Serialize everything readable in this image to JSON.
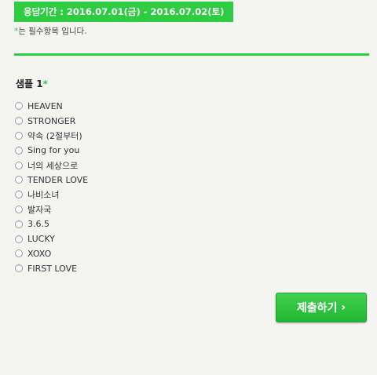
{
  "banner": {
    "period_text": "응답기간 : 2016.07.01(금) - 2016.07.02(토)"
  },
  "required_note": {
    "star": "*",
    "text": "는 필수항목 입니다."
  },
  "question": {
    "title": "샘플 1",
    "required_mark": "*",
    "options": [
      {
        "label": "HEAVEN"
      },
      {
        "label": "STRONGER"
      },
      {
        "label": "약속 (2절부터)"
      },
      {
        "label": "Sing for you"
      },
      {
        "label": "너의 세상으로"
      },
      {
        "label": "TENDER LOVE"
      },
      {
        "label": "나비소녀"
      },
      {
        "label": "발자국"
      },
      {
        "label": "3.6.5"
      },
      {
        "label": "LUCKY"
      },
      {
        "label": "XOXO"
      },
      {
        "label": "FIRST LOVE"
      }
    ]
  },
  "submit": {
    "label": "제출하기",
    "icon": "chevron-right-icon"
  },
  "colors": {
    "accent_green": "#2ecc40",
    "background": "#f4f4f2"
  }
}
